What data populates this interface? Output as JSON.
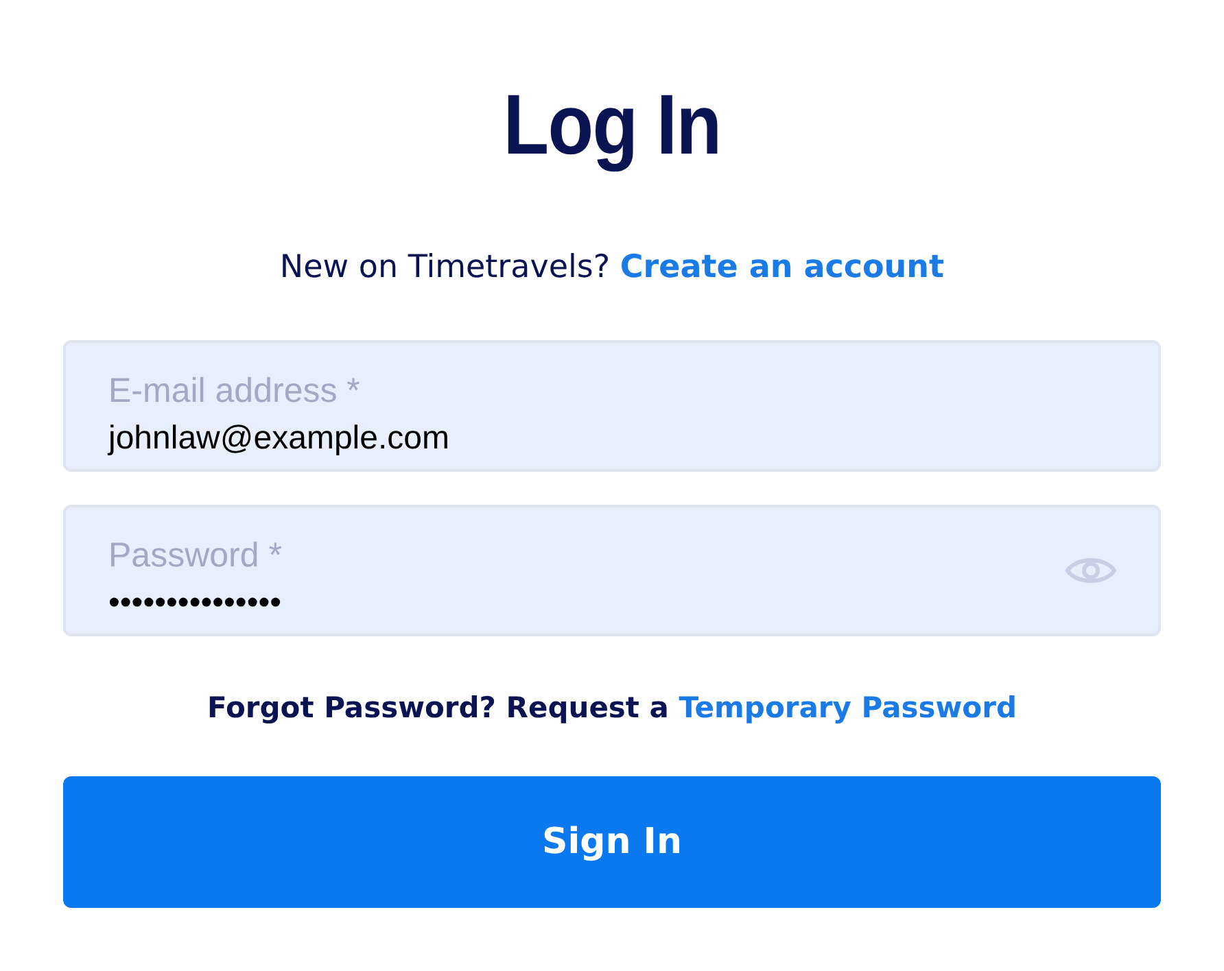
{
  "title": "Log In",
  "signup": {
    "text": "New on Timetravels?",
    "link": "Create an account"
  },
  "fields": [
    {
      "kind": "text",
      "label": "E-mail address *",
      "value": "johnlaw@example.com"
    },
    {
      "kind": "password",
      "label": "Password *",
      "value": "•••••••••••••••"
    }
  ],
  "forgot": {
    "text": "Forgot Password? Request a",
    "link": "Temporary Password"
  },
  "submit": "Sign In"
}
